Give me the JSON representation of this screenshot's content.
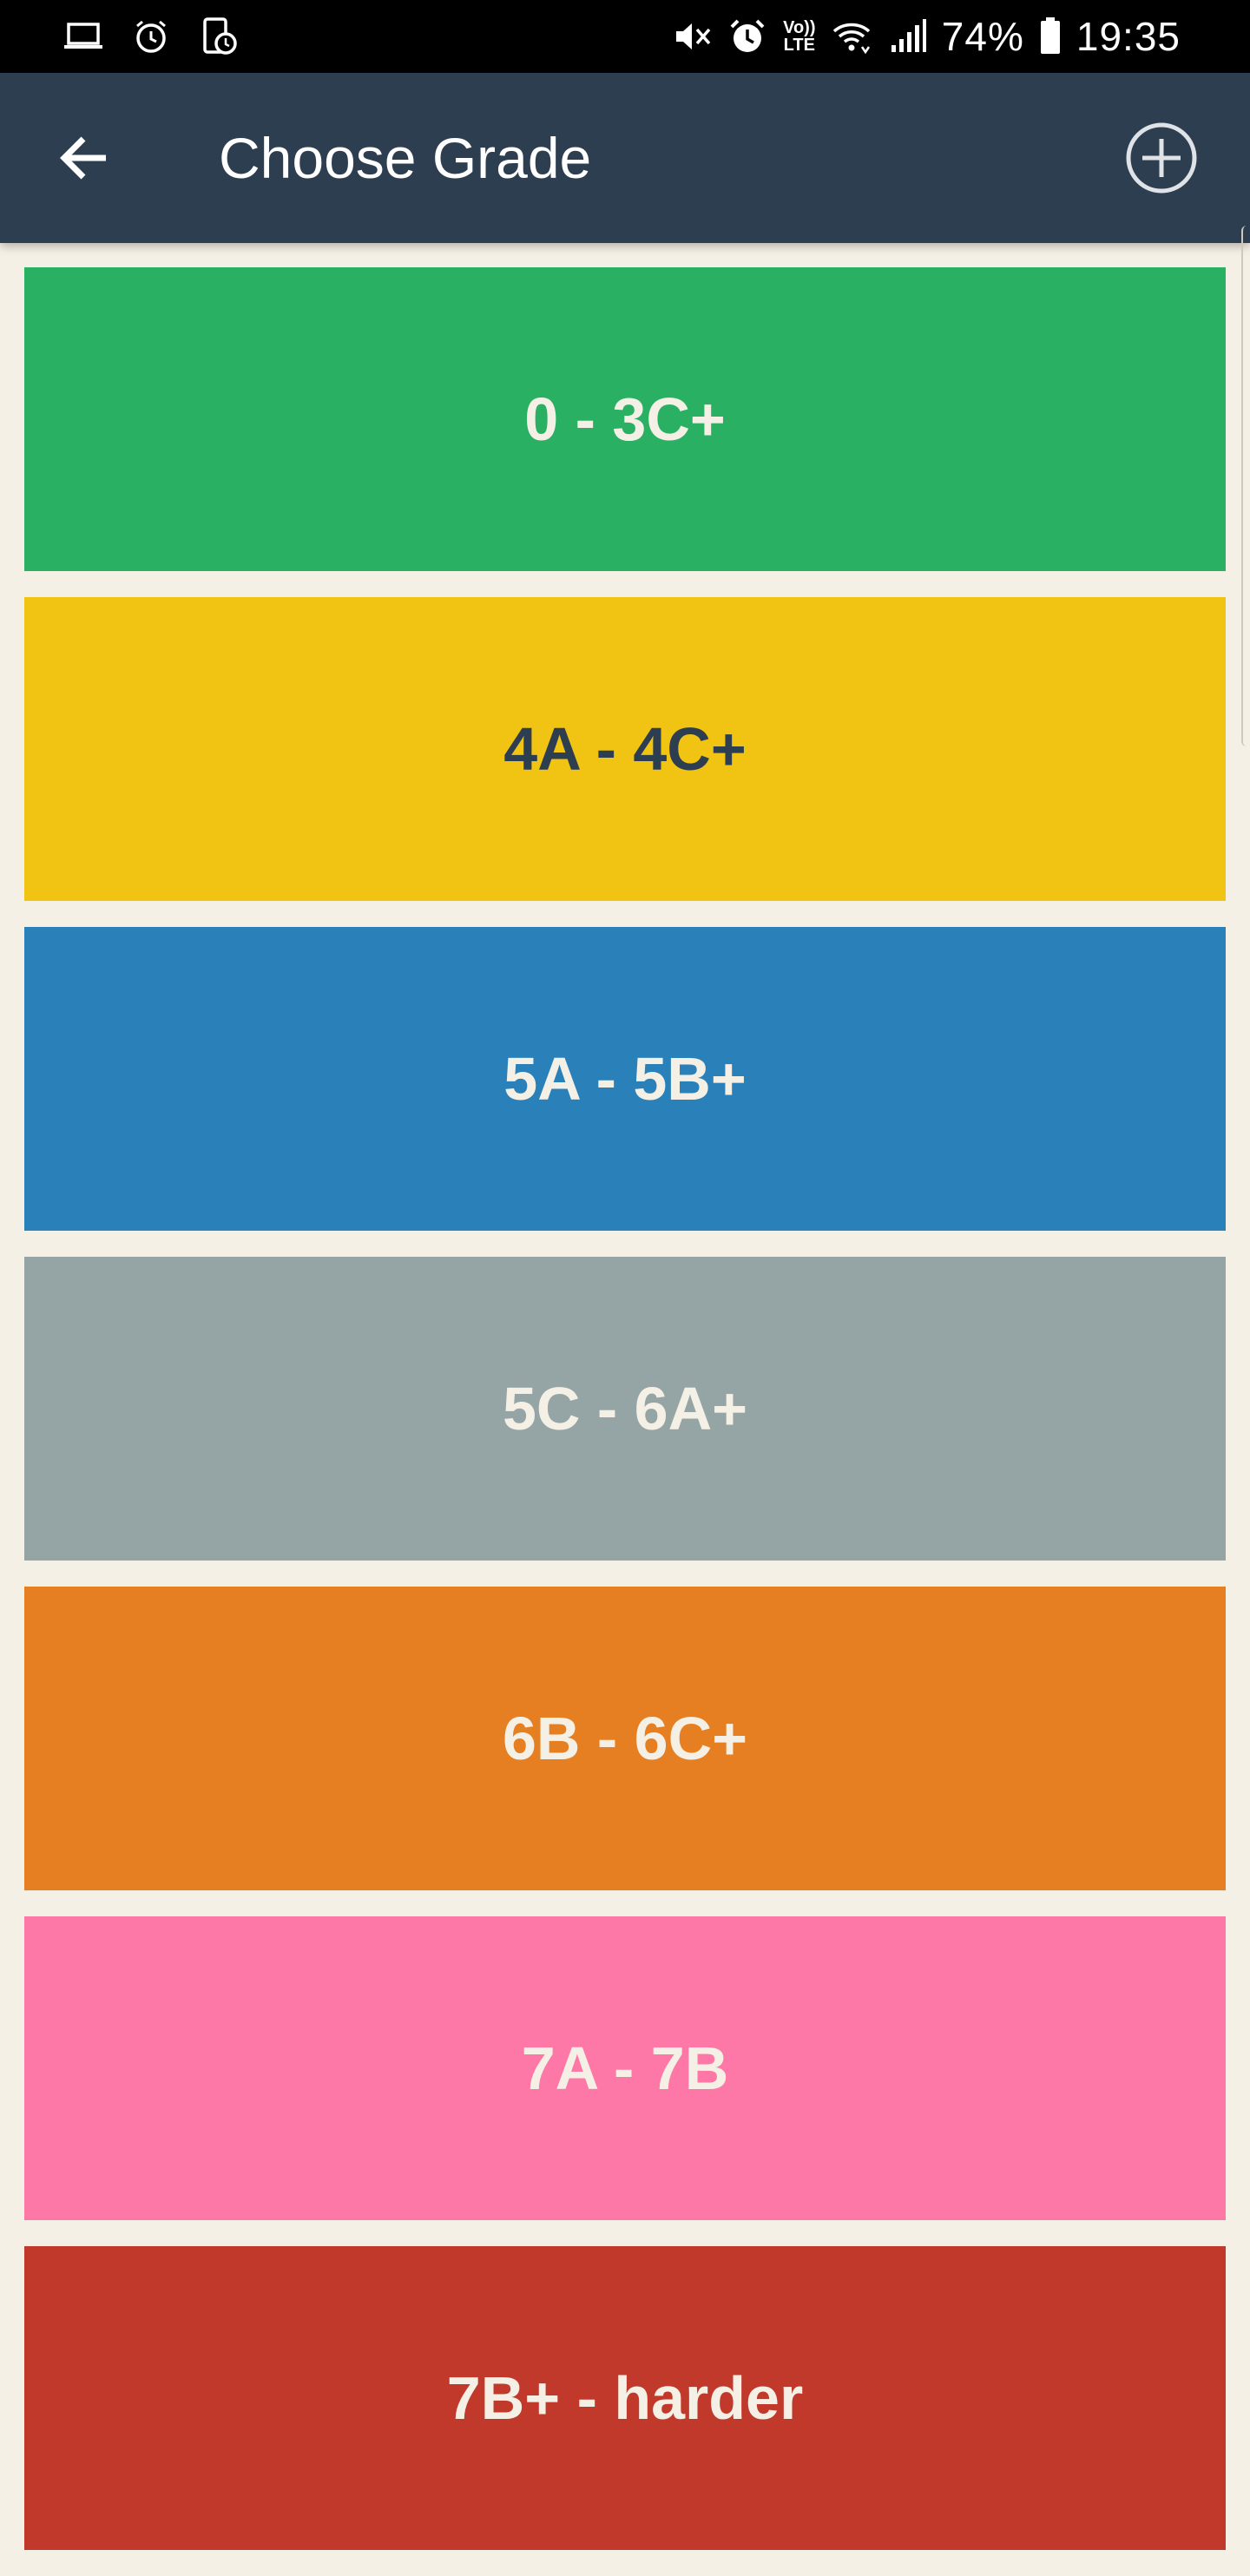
{
  "status_bar": {
    "left_icons": [
      "laptop-icon",
      "alarm-clock-icon",
      "phone-clock-icon"
    ],
    "right_icons": [
      "mute-icon",
      "alarm-icon",
      "volte-icon",
      "wifi-icon",
      "signal-icon",
      "battery-icon"
    ],
    "volte_label_top": "Vo))",
    "volte_label_bottom": "LTE",
    "battery": "74%",
    "time": "19:35"
  },
  "app_bar": {
    "title": "Choose Grade",
    "back_icon": "arrow-back-icon",
    "add_icon": "add-circle-icon",
    "background": "#2e3e51"
  },
  "grades": [
    {
      "label": "0 - 3C+",
      "background": "#2ab063",
      "text_color": "#f5f0e6"
    },
    {
      "label": "4A - 4C+",
      "background": "#f1c413",
      "text_color": "#2e3e51"
    },
    {
      "label": "5A - 5B+",
      "background": "#2a80b9",
      "text_color": "#f5f0e6"
    },
    {
      "label": "5C - 6A+",
      "background": "#95a5a5",
      "text_color": "#f5f0e6"
    },
    {
      "label": "6B - 6C+",
      "background": "#e67f22",
      "text_color": "#f5f0e6"
    },
    {
      "label": "7A - 7B",
      "background": "#fe78a7",
      "text_color": "#f5f0e6"
    },
    {
      "label": "7B+ - harder",
      "background": "#c0392b",
      "text_color": "#f5f0e6"
    }
  ],
  "colors": {
    "page_background": "#f5f0e6",
    "status_bar": "#000000"
  }
}
